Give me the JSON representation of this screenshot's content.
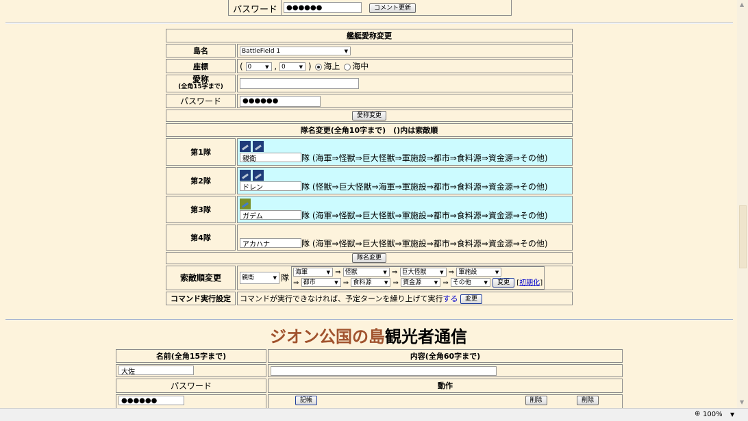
{
  "top_bar": {
    "password_label": "パスワード",
    "password_value": "●●●●●●",
    "comment_button": "コメント更新"
  },
  "rename": {
    "header": "艦艇愛称変更",
    "island_label": "島名",
    "island_value": "BattleField 1",
    "coord_label": "座標",
    "coord_open": "(",
    "coord_x": "0",
    "coord_sep": ",",
    "coord_y": "0",
    "coord_close": ")",
    "sea_surface": "海上",
    "sea_under": "海中",
    "nickname_label": "愛称",
    "nickname_note": "(全角15字まで)",
    "nickname_value": "",
    "password_label": "パスワード",
    "password_value": "●●●●●●",
    "button": "愛称変更"
  },
  "fleet": {
    "header": "隊名変更(全角10字まで)　()内は索敵順",
    "suffix": "隊",
    "rows": [
      {
        "label": "第1隊",
        "name": "親衛",
        "order": "(海軍⇒怪獣⇒巨大怪獣⇒軍施設⇒都市⇒食料源⇒資金源⇒その他)"
      },
      {
        "label": "第2隊",
        "name": "ドレン",
        "order": "(怪獣⇒巨大怪獣⇒海軍⇒軍施設⇒都市⇒食料源⇒資金源⇒その他)"
      },
      {
        "label": "第3隊",
        "name": "ガデム",
        "order": "(海軍⇒怪獣⇒巨大怪獣⇒軍施設⇒都市⇒食料源⇒資金源⇒その他)"
      },
      {
        "label": "第4隊",
        "name": "アカハナ",
        "order": "(海軍⇒怪獣⇒巨大怪獣⇒軍施設⇒都市⇒食料源⇒資金源⇒その他)"
      }
    ],
    "button": "隊名変更"
  },
  "search_order": {
    "label": "索敵順変更",
    "fleet_value": "親衛",
    "suffix": "隊",
    "arrow": "⇒",
    "slots": [
      "海軍",
      "怪獣",
      "巨大怪獣",
      "軍施設",
      "都市",
      "食料源",
      "資金源",
      "その他"
    ],
    "change_button": "変更",
    "reset_open": "[",
    "reset_link": "初期化",
    "reset_close": "]"
  },
  "command": {
    "label": "コマンド実行設定",
    "text": "コマンドが実行できなければ、予定ターンを繰り上げて実行",
    "link": "する",
    "button": "変更"
  },
  "tourist": {
    "title_red": "ジオン公国の島",
    "title_black": "観光者通信",
    "name_header": "名前(全角15字まで)",
    "content_header": "内容(全角60字まで)",
    "name_value": "大佐",
    "content_value": "",
    "password_header": "パスワード",
    "action_header": "動作",
    "password_value": "●●●●●●",
    "btn_a": "記帳",
    "btn_b": "削除",
    "btn_c": "削除"
  },
  "statusbar": {
    "zoom": "100%"
  },
  "colors": {
    "background": "#fdf3dc",
    "cyan_cell": "#ccfbff",
    "title_red": "#a0522d",
    "link_blue": "#0000cc"
  }
}
